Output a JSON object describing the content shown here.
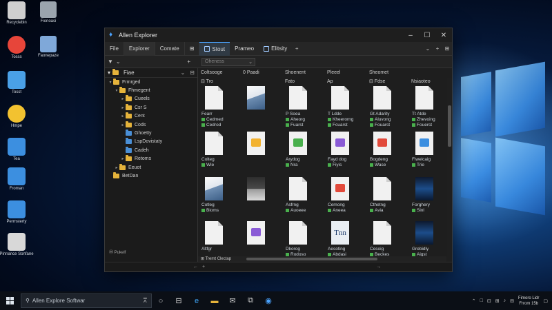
{
  "desktop": {
    "icons_col1": [
      {
        "label": "Recyclebin",
        "icon": "recycle-bin-icon",
        "color": "#cfcfcf"
      },
      {
        "label": "Tosss",
        "icon": "chrome-icon",
        "color": "#e7453a"
      },
      {
        "label": "Tosst",
        "icon": "globe-icon",
        "color": "#4aa0e6"
      },
      {
        "label": "Hmpe",
        "icon": "chrome-icon",
        "color": "#f2c230"
      },
      {
        "label": "Tea",
        "icon": "app-icon",
        "color": "#3c8fe0"
      },
      {
        "label": "Froman",
        "icon": "app-icon",
        "color": "#3c8fe0"
      },
      {
        "label": "Permsterty",
        "icon": "app-icon",
        "color": "#3c8fe0"
      },
      {
        "label": "Pinnance Sonfane",
        "icon": "document-icon",
        "color": "#d8d8d8"
      }
    ],
    "icons_col2": [
      {
        "label": "Fionoasi",
        "icon": "computer-icon",
        "color": "#9aa4ae"
      },
      {
        "label": "Faonepaze",
        "icon": "document-icon",
        "color": "#7fa8d9"
      }
    ]
  },
  "window": {
    "title": "Allen Explorer",
    "controls": {
      "minimize": "–",
      "maximize": "☐",
      "close": "✕"
    },
    "menu": [
      "File",
      "Explorer",
      "Comate",
      "⊞"
    ],
    "tabs": [
      {
        "label": "Stout",
        "active": true
      },
      {
        "label": "Prameo",
        "active": false
      },
      {
        "label": "Elitsity",
        "active": false
      }
    ],
    "tab_add": "+",
    "menubar_right": [
      "⌄",
      "+",
      "⊞"
    ],
    "toolbar": {
      "left_icon": "▼",
      "left_chevron": "⌄",
      "plus": "+",
      "filter_placeholder": "Oheness",
      "filter_chevron": "⌄"
    },
    "sidebar": {
      "header_label": "Fiae",
      "header_controls": [
        "⌄",
        "⊟"
      ],
      "tree": [
        {
          "label": "Frmrged",
          "indent": 0,
          "caret": "▾",
          "color": "yellow"
        },
        {
          "label": "Fhmegent",
          "indent": 1,
          "caret": "▾",
          "color": "yellow"
        },
        {
          "label": "Cueels",
          "indent": 2,
          "caret": "▸",
          "color": "yellow"
        },
        {
          "label": "Csr S",
          "indent": 2,
          "caret": "▸",
          "color": "yellow"
        },
        {
          "label": "Cent",
          "indent": 2,
          "caret": "▸",
          "color": "yellow"
        },
        {
          "label": "Cods",
          "indent": 2,
          "caret": "▸",
          "color": "yellow"
        },
        {
          "label": "Ghoetty",
          "indent": 2,
          "caret": "",
          "color": "blue"
        },
        {
          "label": "LspDovistaty",
          "indent": 2,
          "caret": "",
          "color": "blue"
        },
        {
          "label": "Cadeh",
          "indent": 2,
          "caret": "",
          "color": "blue"
        },
        {
          "label": "Retoms",
          "indent": 2,
          "caret": "▸",
          "color": "yellow"
        },
        {
          "label": "Eeuot",
          "indent": 1,
          "caret": "▸",
          "color": "yellow"
        },
        {
          "label": "BetDan",
          "indent": 0,
          "caret": "",
          "color": "yellow"
        }
      ],
      "footer": "Ⓜ Pukelf"
    },
    "columns": [
      "Coltsooge",
      "0 Paadi",
      "Shoenent",
      "Pleeel",
      "Sheomet"
    ],
    "column_sub": [
      "⊟ Tro",
      "Fato",
      "Ap",
      "⊟ Fdse",
      "Nsiaoteo"
    ],
    "tiles": [
      {
        "kind": "doc",
        "label": [
          "Fearr",
          "Cedmed",
          "Cedrod"
        ]
      },
      {
        "kind": "img",
        "label": []
      },
      {
        "kind": "doc",
        "label": [
          "P Soea",
          "Aheorg",
          "Fuarst"
        ]
      },
      {
        "kind": "doc",
        "label": [
          "T Ldde",
          "Kheerorng",
          "Fcuarst"
        ]
      },
      {
        "kind": "doc",
        "label": [
          "Gt Adarity",
          "Aluvong",
          "Fouarst"
        ]
      },
      {
        "kind": "doc",
        "label": [
          "Tt Atde",
          "Zhevoing",
          "Fouerst"
        ]
      },
      {
        "kind": "doc",
        "label": [
          "Colteg",
          "Wie"
        ]
      },
      {
        "kind": "img2",
        "label": []
      },
      {
        "kind": "img2",
        "label": [
          "Arydog",
          "Nra"
        ]
      },
      {
        "kind": "img2",
        "label": [
          "Fayd dog",
          "Fiyis"
        ]
      },
      {
        "kind": "img2",
        "label": [
          "Bogdeng",
          "Wase"
        ]
      },
      {
        "kind": "img2",
        "label": [
          "Fiwelcaig",
          "Trie"
        ]
      },
      {
        "kind": "img",
        "label": [
          "Cotleg",
          "Bioms"
        ]
      },
      {
        "kind": "img3",
        "label": []
      },
      {
        "kind": "doc",
        "label": [
          "Asfrng",
          "Auoeee"
        ]
      },
      {
        "kind": "img2",
        "label": [
          "Cemong",
          "Aneea"
        ]
      },
      {
        "kind": "doc",
        "label": [
          "Cthetng",
          "Avia"
        ]
      },
      {
        "kind": "media",
        "label": [
          "Forghery",
          "Sinl"
        ]
      },
      {
        "kind": "doc",
        "label": [
          "Altfgr"
        ]
      },
      {
        "kind": "img2",
        "label": []
      },
      {
        "kind": "doc",
        "label": [
          "Dkorog",
          "Rodoso"
        ]
      },
      {
        "kind": "mono",
        "text": "Tnn",
        "label": [
          "Aesoting",
          "Abdasi"
        ]
      },
      {
        "kind": "doc",
        "label": [
          "Cesoig",
          "Beckes"
        ]
      },
      {
        "kind": "media",
        "label": [
          "Grebidly",
          "Aigst"
        ]
      },
      {
        "kind": "img",
        "label": []
      },
      {
        "kind": "img3",
        "label": []
      },
      {
        "kind": "doc",
        "label": []
      },
      {
        "kind": "doc",
        "label": []
      },
      {
        "kind": "img3",
        "label": []
      },
      {
        "kind": "media",
        "label": []
      }
    ],
    "hscroll_label": "⊞ Tremt Clectap",
    "status_right": "→",
    "status_left": [
      "←",
      "+"
    ]
  },
  "taskbar": {
    "search_placeholder": "Allen Explore Softwar",
    "search_icon": "search-icon",
    "mic": "⩞",
    "apps": [
      "○",
      "⊟",
      "e",
      "▬",
      "✉",
      "⧉",
      "◉"
    ],
    "tray": [
      "⌃",
      "□",
      "⊡",
      "⊞",
      "♪",
      "⊟"
    ],
    "clock_line1": "Fimoro Lidr",
    "clock_line2": "Frrom 15b",
    "notify": "▢"
  }
}
